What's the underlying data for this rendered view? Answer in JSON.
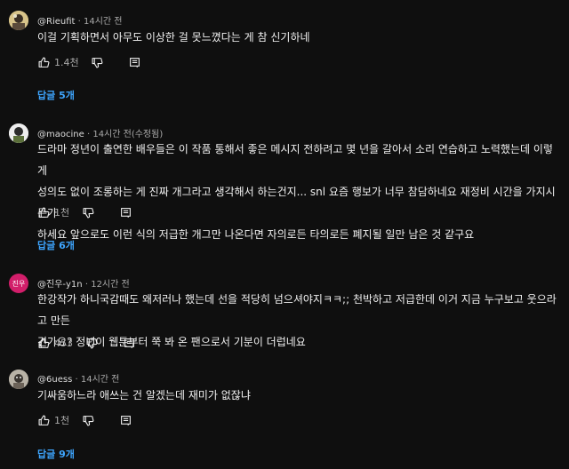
{
  "comments": [
    {
      "author": "@Rieufit",
      "sep": "·",
      "time": "14시간 전",
      "lines": [
        "이걸 기획하면서 아무도 이상한 걸 못느꼈다는 게 참 신기하네"
      ],
      "likes": "1.4천",
      "replies": "답글 5개"
    },
    {
      "author": "@maocine",
      "sep": "·",
      "time": "14시간 전(수정됨)",
      "lines": [
        "드라마 정년이 출연한 배우들은 이 작품 통해서 좋은 메시지 전하려고 몇 년을 갈아서 소리 연습하고 노력했는데 이렇게",
        "성의도 없이 조롱하는 게 진짜 개그라고 생각해서 하는건지... snl 요즘 행보가 너무 참담하네요 재정비 시간을 가지시든가",
        "하세요 앞으로도 이런 식의 저급한 개그만 나온다면 자의로든 타의로든 폐지될 일만 남은 것 같구요"
      ],
      "likes": "1천",
      "replies": "답글 6개"
    },
    {
      "author": "@진우-y1n",
      "sep": "·",
      "time": "12시간 전",
      "avatar_text": "진우",
      "lines": [
        "한강작가 하니국감때도 왜저러나 했는데 선을 적당히 넘으셔야지ㅋㅋ;; 천박하고 저급한데 이거 지금 누구보고 웃으라고 만든",
        "건가요? 정년이 웹툰부터 쭉 봐 온 팬으로서 기분이 더럽네요"
      ],
      "likes": "453",
      "replies": ""
    },
    {
      "author": "@6uess",
      "sep": "·",
      "time": "14시간 전",
      "lines": [
        "기싸움하느라 애쓰는 건 알겠는데 재미가 없잖냐"
      ],
      "likes": "1천",
      "replies": "답글 9개"
    }
  ],
  "icons": {
    "like": "thumbs-up-icon",
    "dislike": "thumbs-down-icon",
    "reply": "reply-icon"
  },
  "colors": {
    "background": "#0f0f0f",
    "text": "#f1f1f1",
    "muted": "#aaaaaa",
    "link": "#3ea6ff",
    "avatar_jinwoo": "#d21e6a"
  }
}
